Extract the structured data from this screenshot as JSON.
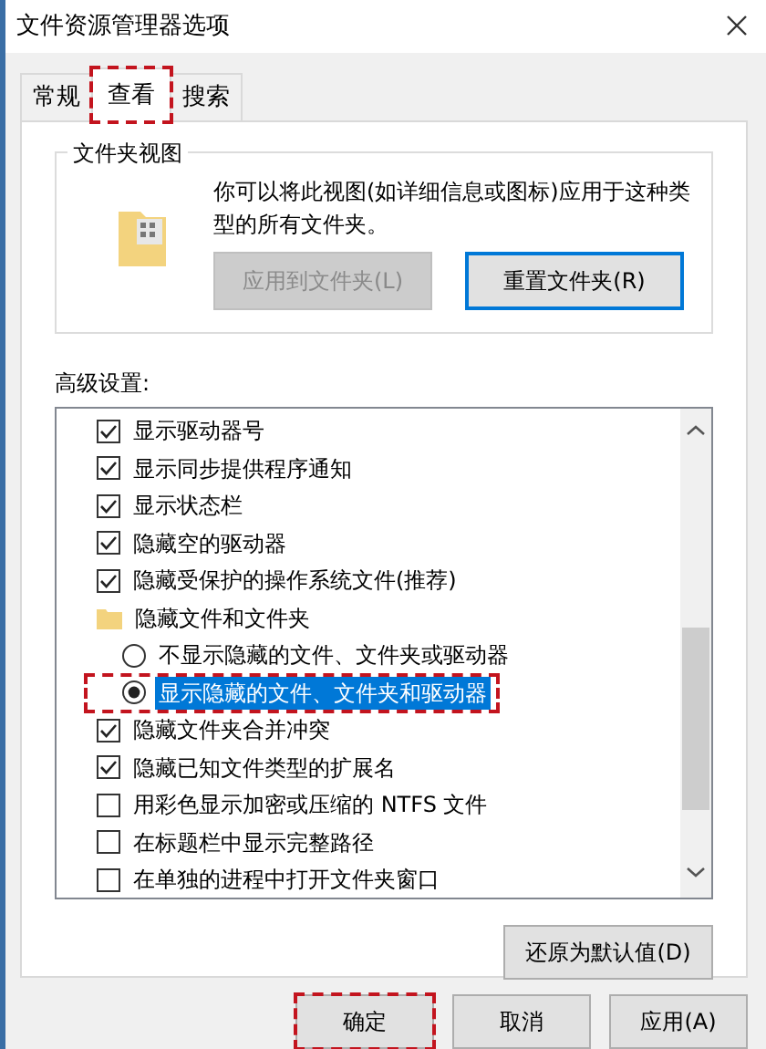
{
  "window": {
    "title": "文件资源管理器选项"
  },
  "tabs": [
    {
      "label": "常规",
      "selected": false,
      "annotated": false
    },
    {
      "label": "查看",
      "selected": true,
      "annotated": true
    },
    {
      "label": "搜索",
      "selected": false,
      "annotated": false
    }
  ],
  "folder_views": {
    "legend": "文件夹视图",
    "description": "你可以将此视图(如详细信息或图标)应用于这种类型的所有文件夹。",
    "buttons": [
      {
        "label": "应用到文件夹(L)",
        "disabled": true,
        "focused": false
      },
      {
        "label": "重置文件夹(R)",
        "disabled": false,
        "focused": true
      }
    ]
  },
  "advanced": {
    "label": "高级设置:",
    "items": [
      {
        "kind": "checkbox",
        "label": "显示驱动器号",
        "checked": true
      },
      {
        "kind": "checkbox",
        "label": "显示同步提供程序通知",
        "checked": true
      },
      {
        "kind": "checkbox",
        "label": "显示状态栏",
        "checked": true
      },
      {
        "kind": "checkbox",
        "label": "隐藏空的驱动器",
        "checked": true
      },
      {
        "kind": "checkbox",
        "label": "隐藏受保护的操作系统文件(推荐)",
        "checked": true
      },
      {
        "kind": "folder",
        "label": "隐藏文件和文件夹"
      },
      {
        "kind": "radio",
        "label": "不显示隐藏的文件、文件夹或驱动器",
        "selected": false,
        "highlighted": false,
        "annotated": false
      },
      {
        "kind": "radio",
        "label": "显示隐藏的文件、文件夹和驱动器",
        "selected": true,
        "highlighted": true,
        "annotated": true
      },
      {
        "kind": "checkbox",
        "label": "隐藏文件夹合并冲突",
        "checked": true
      },
      {
        "kind": "checkbox",
        "label": "隐藏已知文件类型的扩展名",
        "checked": true
      },
      {
        "kind": "checkbox",
        "label": "用彩色显示加密或压缩的 NTFS 文件",
        "checked": false
      },
      {
        "kind": "checkbox",
        "label": "在标题栏中显示完整路径",
        "checked": false
      },
      {
        "kind": "checkbox",
        "label": "在单独的进程中打开文件夹窗口",
        "checked": false
      }
    ],
    "restore_button": "还原为默认值(D)"
  },
  "buttons": [
    {
      "label": "确定",
      "annotated": true
    },
    {
      "label": "取消",
      "annotated": false
    },
    {
      "label": "应用(A)",
      "annotated": false
    }
  ]
}
